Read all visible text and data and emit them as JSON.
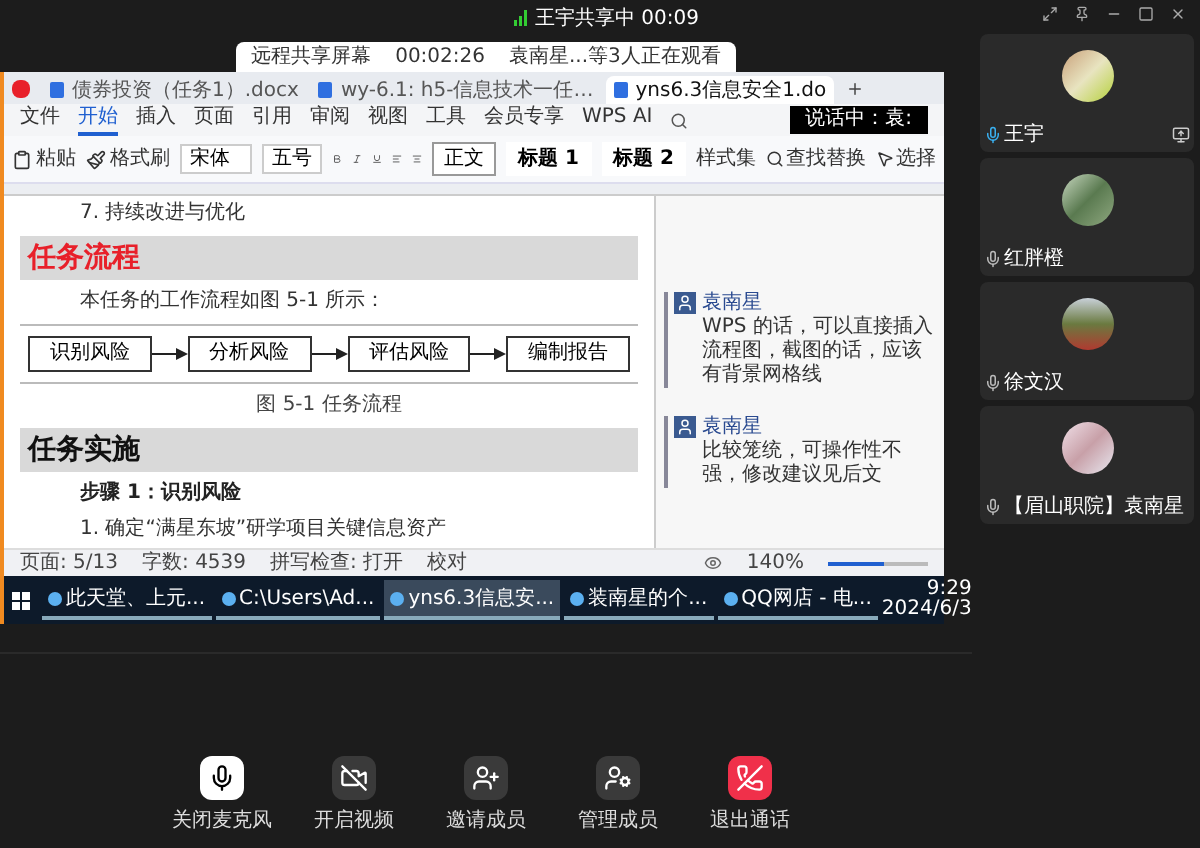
{
  "call": {
    "sharing_status": "王宇共享中 00:09"
  },
  "share_banner": {
    "label": "远程共享屏幕",
    "timer": "00:02:26",
    "viewers": "袁南星...等3人正在观看"
  },
  "shared_screen": {
    "tabs": [
      {
        "label": "债券投资（任务1）.docx",
        "selected": false
      },
      {
        "label": "wy-6.1: h5-信息技术一任…",
        "selected": false
      },
      {
        "label": "yns6.3信息安全1.do",
        "selected": true
      }
    ],
    "menu": [
      {
        "label": "文件",
        "selected": false
      },
      {
        "label": "开始",
        "selected": true
      },
      {
        "label": "插入",
        "selected": false
      },
      {
        "label": "页面",
        "selected": false
      },
      {
        "label": "引用",
        "selected": false
      },
      {
        "label": "审阅",
        "selected": false
      },
      {
        "label": "视图",
        "selected": false
      },
      {
        "label": "工具",
        "selected": false
      },
      {
        "label": "会员专享",
        "selected": false
      },
      {
        "label": "WPS AI",
        "selected": false
      }
    ],
    "speaking_toast": "说话中：袁:",
    "ribbon": {
      "paste": "粘贴",
      "format_painter": "格式刷",
      "font": "宋体",
      "size": "五号",
      "styles": [
        {
          "label": "正文",
          "selected": true
        },
        {
          "label": "标题 1",
          "selected": false
        },
        {
          "label": "标题 2",
          "selected": false
        }
      ],
      "style_set": "样式集",
      "find": "查找替换",
      "select": "选择"
    },
    "document": [
      {
        "kind": "text",
        "text": "7. 持续改进与优化"
      },
      {
        "kind": "heading",
        "text": "任务流程",
        "color": "#e8202a"
      },
      {
        "kind": "text",
        "text": "本任务的工作流程如图 5-1 所示："
      },
      {
        "kind": "flowchart",
        "steps": [
          "识别风险",
          "分析风险",
          "评估风险",
          "编制报告"
        ]
      },
      {
        "kind": "caption",
        "text": "图 5-1 任务流程"
      },
      {
        "kind": "heading",
        "text": "任务实施",
        "color": "#111111"
      },
      {
        "kind": "bold",
        "text": "步骤 1：识别风险"
      },
      {
        "kind": "text",
        "text": "1. 确定“满星东坡”研学项目关键信息资产"
      }
    ],
    "comments": [
      {
        "author": "袁南星",
        "text": "WPS 的话，可以直接插入流程图，截图的话，应该有背景网格线"
      },
      {
        "author": "袁南星",
        "text": "比较笼统，可操作性不强，修改建议见后文"
      }
    ],
    "status_bar": {
      "items": [
        "页面: 5/13",
        "字数: 4539",
        "拼写检查: 打开",
        "校对"
      ],
      "zoom": "140%",
      "level": 0.55
    },
    "taskbar": {
      "items": [
        {
          "label": "此天堂、上元...",
          "selected": false
        },
        {
          "label": "C:\\Users\\Ad...",
          "selected": false
        },
        {
          "label": "yns6.3信息安...",
          "selected": true
        },
        {
          "label": "装南星的个...",
          "selected": false
        },
        {
          "label": "QQ网店 - 电...",
          "selected": false
        }
      ],
      "time": "9:29",
      "date": "2024/6/3"
    }
  },
  "participants": [
    {
      "name": "王宇",
      "speaking": true,
      "sharing": true
    },
    {
      "name": "红胖橙",
      "speaking": false,
      "sharing": false
    },
    {
      "name": "徐文汉",
      "speaking": false,
      "sharing": false
    },
    {
      "name": "【眉山职院】袁南星",
      "speaking": false,
      "sharing": false
    }
  ],
  "controls": [
    {
      "label": "关闭麦克风",
      "kind": "mic"
    },
    {
      "label": "开启视频",
      "kind": "video"
    },
    {
      "label": "邀请成员",
      "kind": "invite"
    },
    {
      "label": "管理成员",
      "kind": "manage"
    },
    {
      "label": "退出通话",
      "kind": "leave"
    }
  ]
}
